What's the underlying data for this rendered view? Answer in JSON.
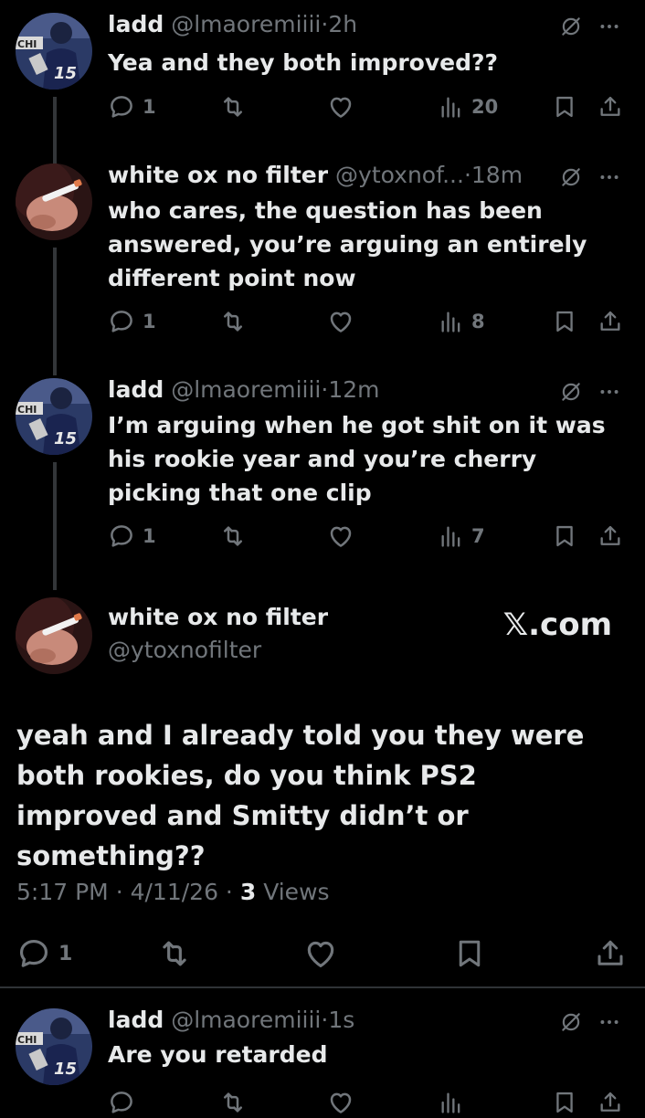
{
  "replies": [
    {
      "name": "ladd",
      "handle": "@lmaoremiiii",
      "sep": "·",
      "time": "2h",
      "text": "Yea and they both improved??",
      "replies_count": "1",
      "views": "20",
      "avatar": "player-avatar"
    },
    {
      "name": "white ox no filter",
      "handle": "@ytoxnof...",
      "sep": "·",
      "time": "18m",
      "text": "who cares, the question has been answered, you’re arguing an entirely different point now",
      "replies_count": "1",
      "views": "8",
      "avatar": "hand-avatar"
    },
    {
      "name": "ladd",
      "handle": "@lmaoremiiii",
      "sep": "·",
      "time": "12m",
      "text": "I’m arguing when he got shit on it was his rookie year and you’re cherry picking that one clip",
      "replies_count": "1",
      "views": "7",
      "avatar": "player-avatar"
    }
  ],
  "main": {
    "name": "white ox no filter",
    "handle": "@ytoxnofilter",
    "brand": "𝕏.com",
    "text": "yeah and I already told you they were both rookies, do you think PS2 improved and Smitty didn’t or something??",
    "time": "5:17 PM",
    "sep1": "·",
    "date": "4/11/26",
    "sep2": "·",
    "views_count": "3",
    "views_label": "Views",
    "replies_count": "1"
  },
  "last_reply": {
    "name": "ladd",
    "handle": "@lmaoremiiii",
    "sep": "·",
    "time": "1s",
    "text": "Are you retarded"
  },
  "colors": {
    "background": "#000000",
    "text": "#e7e9ea",
    "muted": "#71767b",
    "divider": "#2f3336"
  }
}
